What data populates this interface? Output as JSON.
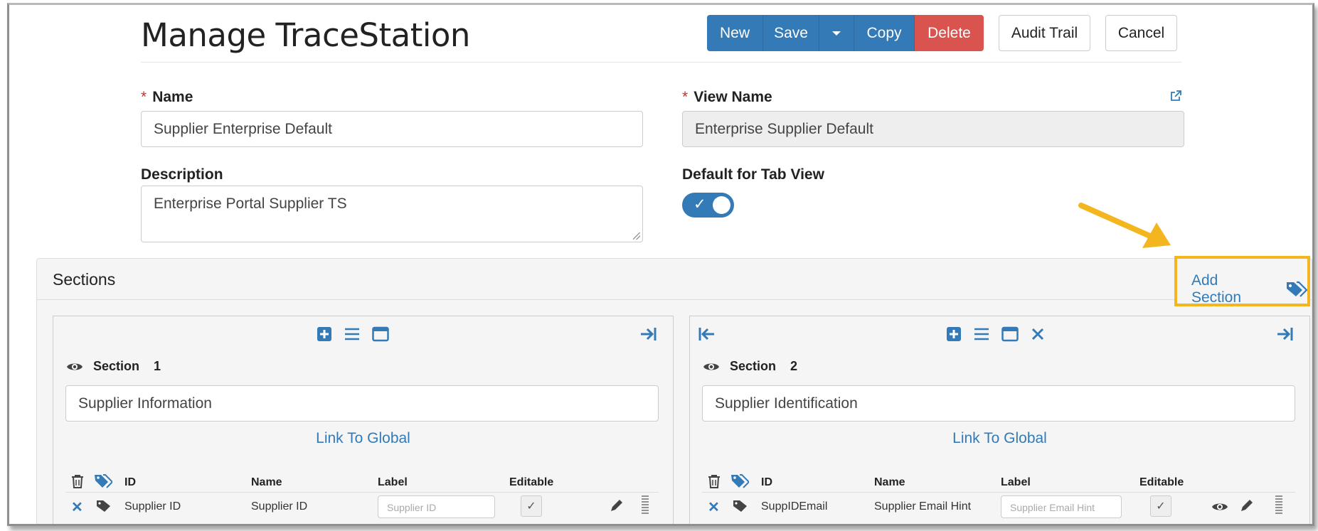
{
  "header": {
    "title": "Manage TraceStation",
    "buttons": {
      "new": "New",
      "save": "Save",
      "copy": "Copy",
      "delete": "Delete",
      "audit_trail": "Audit Trail",
      "cancel": "Cancel"
    }
  },
  "form": {
    "name": {
      "label": "Name",
      "required": "*",
      "value": "Supplier Enterprise Default"
    },
    "view_name": {
      "label": "View Name",
      "required": "*",
      "value": "Enterprise Supplier Default"
    },
    "description": {
      "label": "Description",
      "value": "Enterprise Portal Supplier TS"
    },
    "default_for_tab_view": {
      "label": "Default for Tab View",
      "on": true,
      "check_glyph": "✓"
    }
  },
  "sections": {
    "title": "Sections",
    "add_section_label": "Add Section",
    "highlight_color": "#f3b61f",
    "cards": [
      {
        "section_word": "Section",
        "number": "1",
        "name_value": "Supplier Information",
        "link_label": "Link To Global",
        "columns": {
          "id": "ID",
          "name": "Name",
          "label": "Label",
          "editable": "Editable"
        },
        "row": {
          "id": "Supplier ID",
          "name": "Supplier ID",
          "label_placeholder": "Supplier ID",
          "editable_glyph": "✓"
        }
      },
      {
        "section_word": "Section",
        "number": "2",
        "name_value": "Supplier Identification",
        "link_label": "Link To Global",
        "columns": {
          "id": "ID",
          "name": "Name",
          "label": "Label",
          "editable": "Editable"
        },
        "row": {
          "id": "SuppIDEmail",
          "name": "Supplier Email Hint",
          "label_placeholder": "Supplier Email Hint",
          "editable_glyph": "✓"
        }
      }
    ]
  },
  "colors": {
    "primary": "#337ab7",
    "danger": "#d9534f",
    "annotation": "#f3b61f"
  }
}
